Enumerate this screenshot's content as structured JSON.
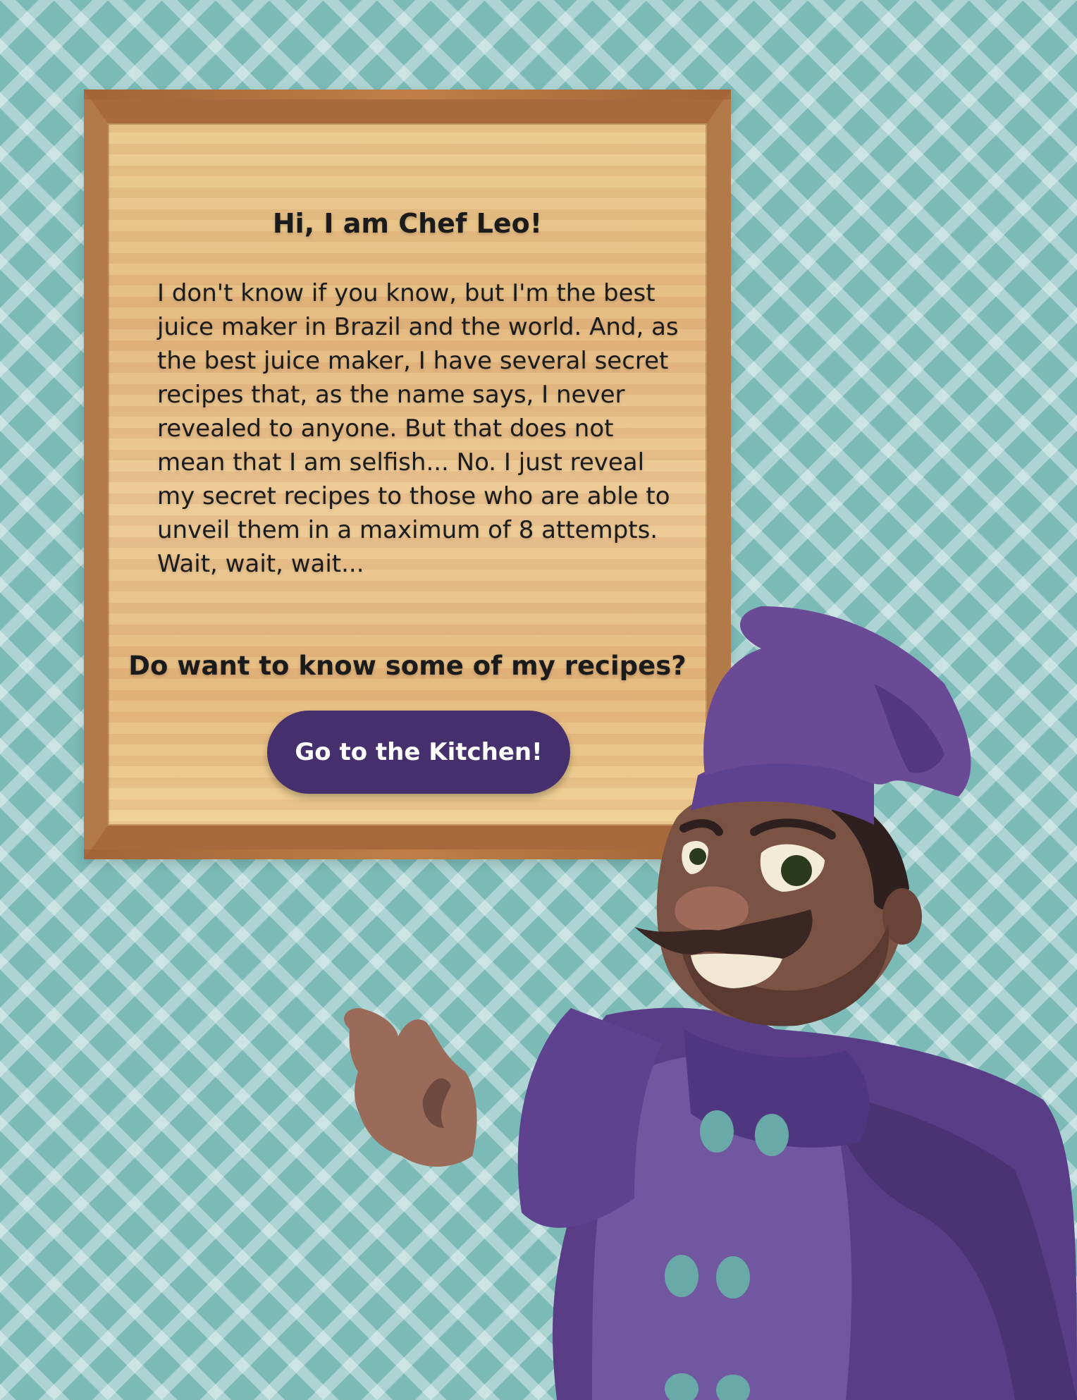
{
  "dialog": {
    "title": "Hi, I am Chef Leo!",
    "intro": "I don't know if you know, but I'm the best juice maker in Brazil and the world. And, as the best juice maker, I have several secret recipes that, as the name says, I never revealed to anyone. But that does not mean that I am selfish... No. I just reveal my secret recipes to those who are able to unveil them in a maximum of 8 attempts. Wait, wait, wait...",
    "question": "Do want to know some of my recipes?",
    "button_label": "Go to the Kitchen!"
  },
  "colors": {
    "background": "#7bbab7",
    "board_wood": "#e3b77e",
    "board_frame": "#a86a3c",
    "button": "#45306d",
    "chef_uniform": "#6a4a95",
    "chef_skin": "#7a5345"
  },
  "icons": {
    "chef": "chef-illustration"
  }
}
